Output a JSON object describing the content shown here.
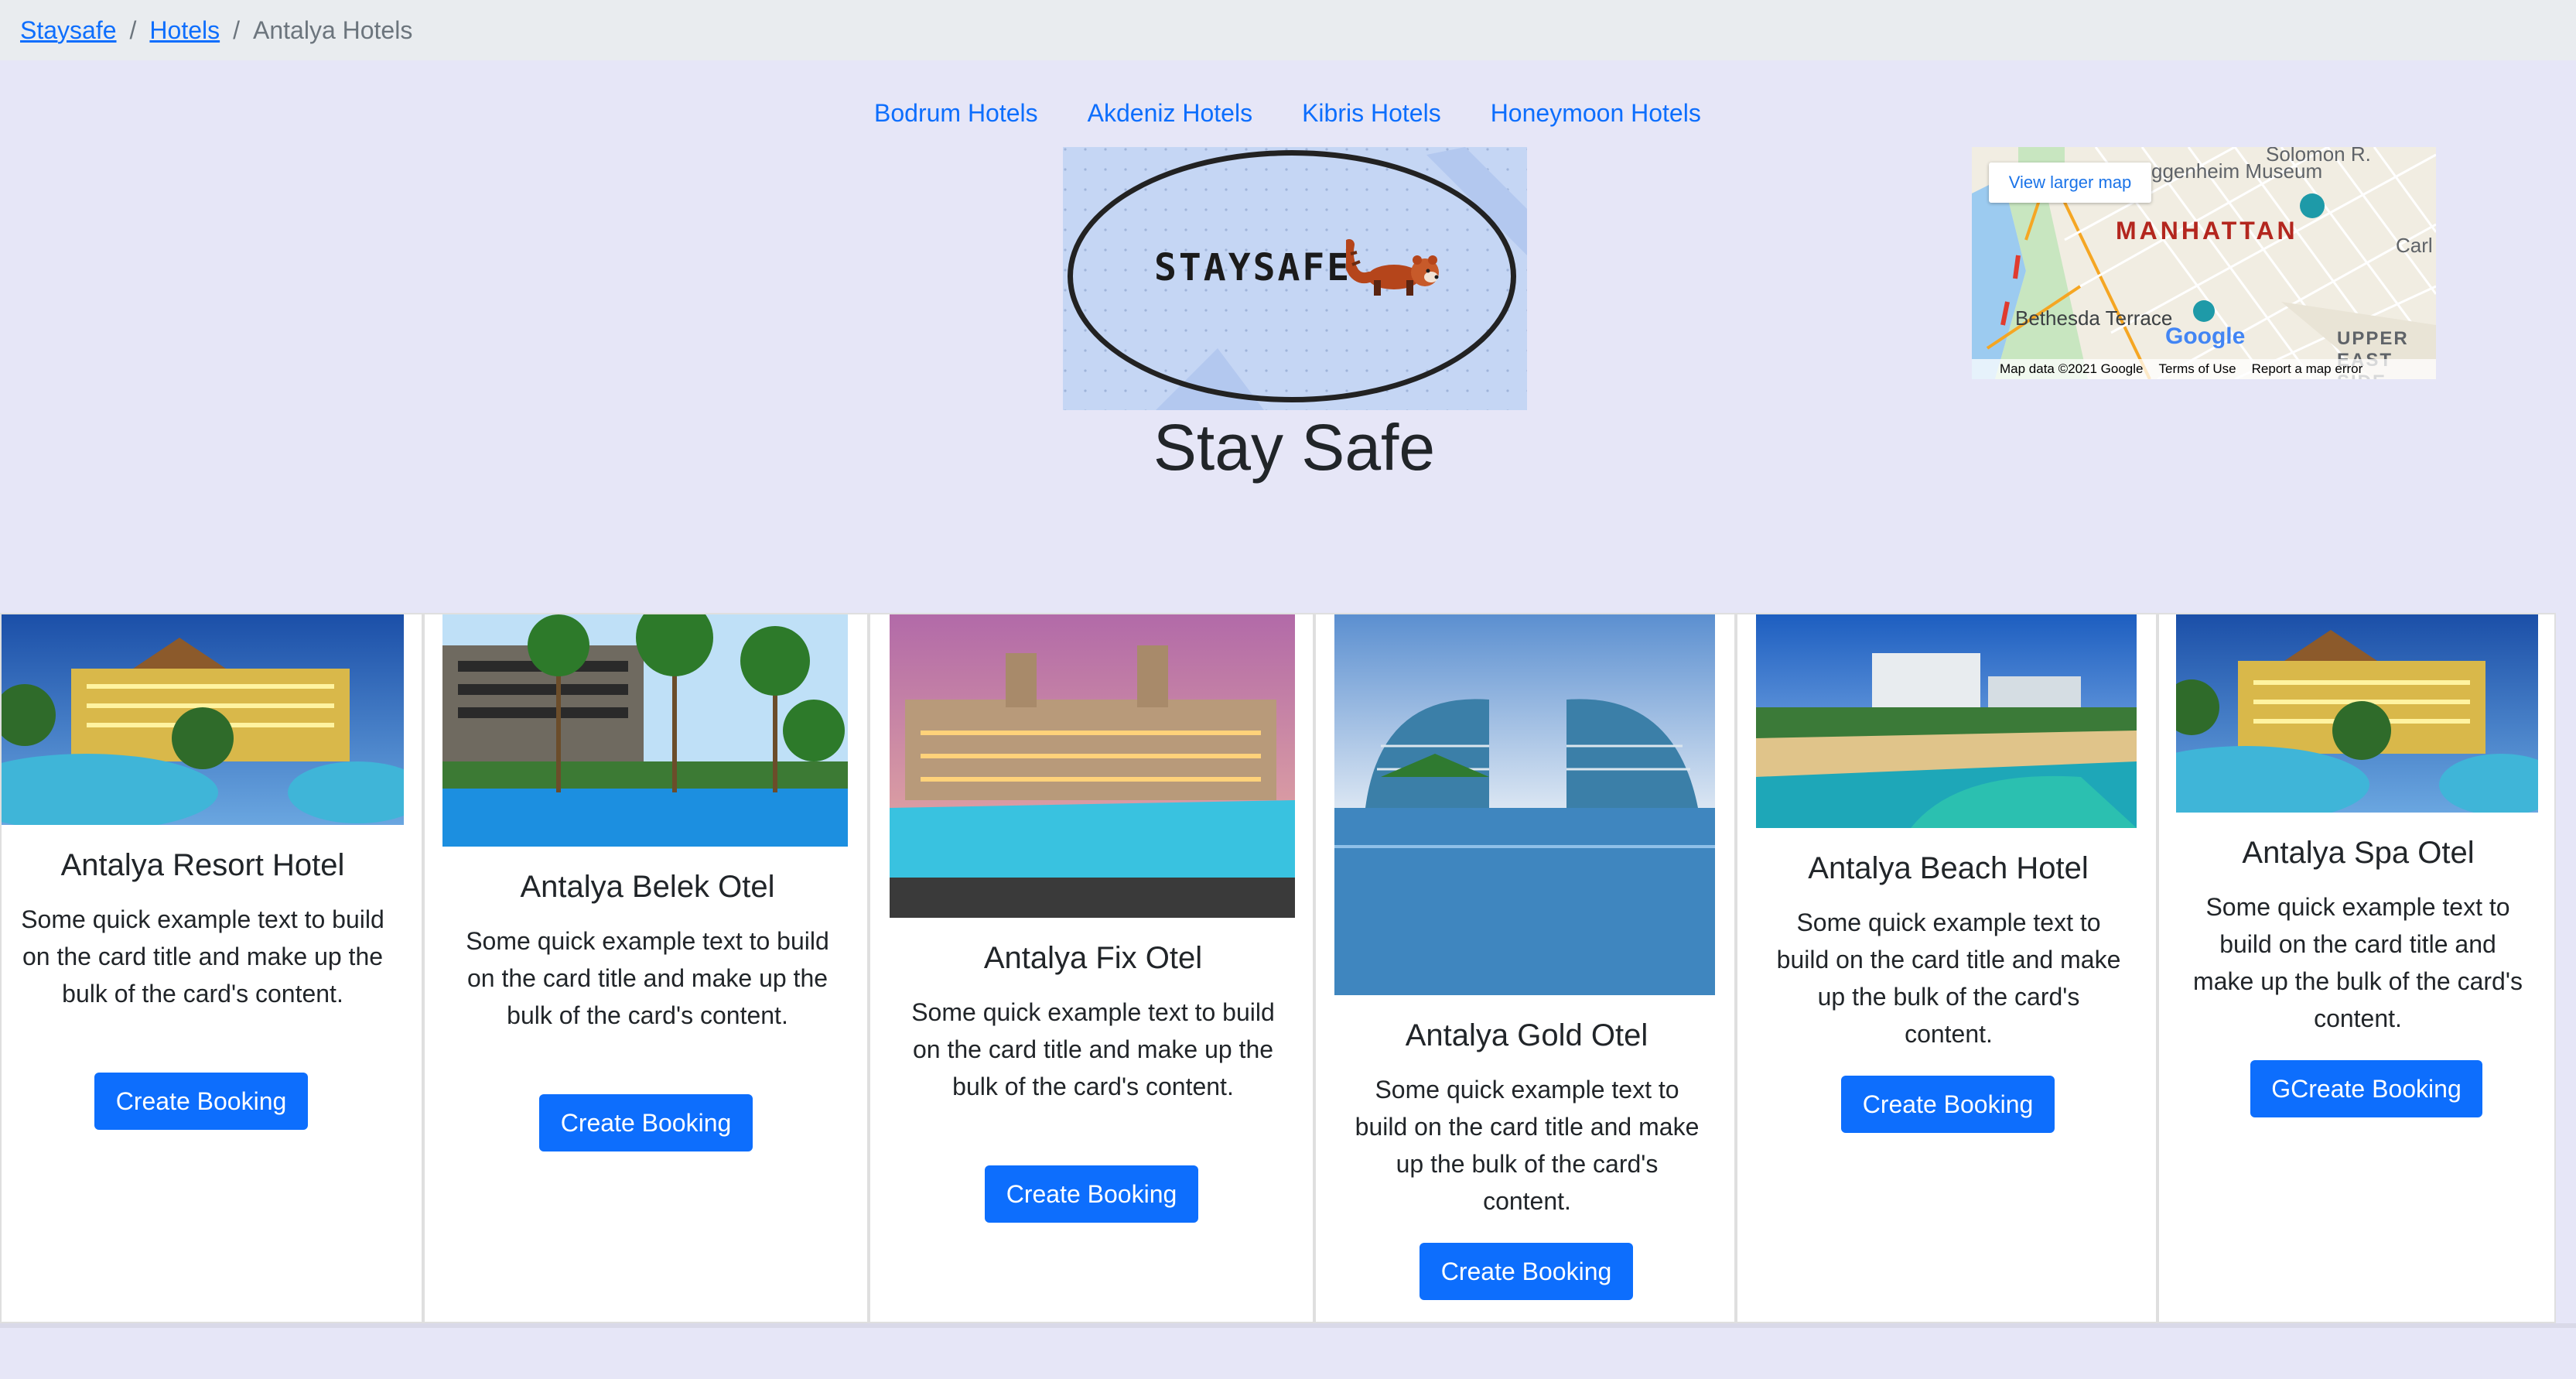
{
  "breadcrumb": {
    "items": [
      {
        "label": "Staysafe"
      },
      {
        "label": "Hotels"
      },
      {
        "label": "Antalya Hotels"
      }
    ],
    "separator": "/"
  },
  "nav": {
    "links": [
      "Bodrum Hotels",
      "Akdeniz Hotels",
      "Kibris Hotels",
      "Honeymoon Hotels"
    ]
  },
  "logo": {
    "text": "STAYSAFE",
    "icon": "red-panda-icon"
  },
  "page_title": "Stay Safe",
  "map": {
    "button_label": "View larger map",
    "city": "MANHATTAN",
    "labels": [
      "Solomon R.",
      "ggenheim Museum",
      "Bethesda Terrace",
      "UPPER EAST SIDE",
      "Carl",
      "Google"
    ],
    "footer": [
      "Map data ©2021 Google",
      "Terms of Use",
      "Report a map error"
    ]
  },
  "cards": [
    {
      "title": "Antalya Resort Hotel",
      "text": "Some quick example text to build on the card title and make up the bulk of the card's content.",
      "button": "Create Booking"
    },
    {
      "title": "Antalya Belek Otel",
      "text": "Some quick example text to build on the card title and make up the bulk of the card's content.",
      "button": "Create Booking"
    },
    {
      "title": "Antalya Fix Otel",
      "text": "Some quick example text to build on the card title and make up the bulk of the card's content.",
      "button": "Create Booking"
    },
    {
      "title": "Antalya Gold Otel",
      "text": "Some quick example text to build on the card title and make up the bulk of the card's content.",
      "button": "Create Booking"
    },
    {
      "title": "Antalya Beach Hotel",
      "text": "Some quick example text to build on the card title and make up the bulk of the card's content.",
      "button": "Create Booking"
    },
    {
      "title": "Antalya Spa Otel",
      "text": "Some quick example text to build on the card title and make up the bulk of the card's content.",
      "button": "GCreate Booking"
    }
  ],
  "colors": {
    "page_bg": "#e6e6f7",
    "primary": "#0d6efd",
    "breadcrumb_bg": "#e9ecef"
  }
}
